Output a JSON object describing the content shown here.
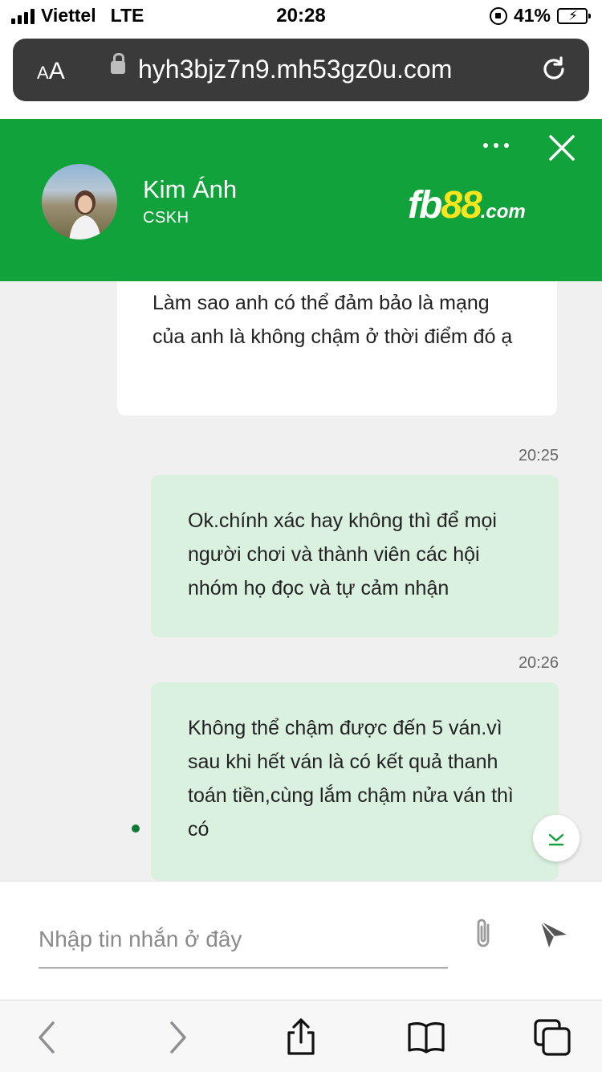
{
  "status_bar": {
    "carrier": "Viettel",
    "network": "LTE",
    "time": "20:28",
    "battery": "41%"
  },
  "browser": {
    "text_size_label_small": "A",
    "text_size_label_big": "A",
    "url": "hyh3bjz7n9.mh53gz0u.com"
  },
  "chat_header": {
    "agent_name": "Kim Ánh",
    "agent_role": "CSKH",
    "brand_fb": "fb",
    "brand_num": "88",
    "brand_domain": ".com",
    "brand_color": "#11a23b"
  },
  "messages": [
    {
      "direction": "in",
      "text": "Làm sao anh có thể đảm bảo là mạng của anh là không chậm ở thời điểm đó ạ"
    },
    {
      "direction": "out",
      "time": "20:25",
      "text": "Ok.chính xác hay không thì để mọi người chơi và thành viên các hội nhóm họ đọc và tự cảm nhận"
    },
    {
      "direction": "out",
      "time": "20:26",
      "text": "Không thể chậm được đến 5 ván.vì sau khi hết ván là có kết quả thanh toán tiền,cùng lắm chậm nửa ván thì có"
    }
  ],
  "composer": {
    "placeholder": "Nhập tin nhắn ở đây",
    "icons": [
      "paperclip-icon",
      "send-icon"
    ]
  },
  "toolbar": {
    "icons": [
      "back-icon",
      "forward-icon",
      "share-icon",
      "bookmarks-icon",
      "tabs-icon"
    ]
  }
}
